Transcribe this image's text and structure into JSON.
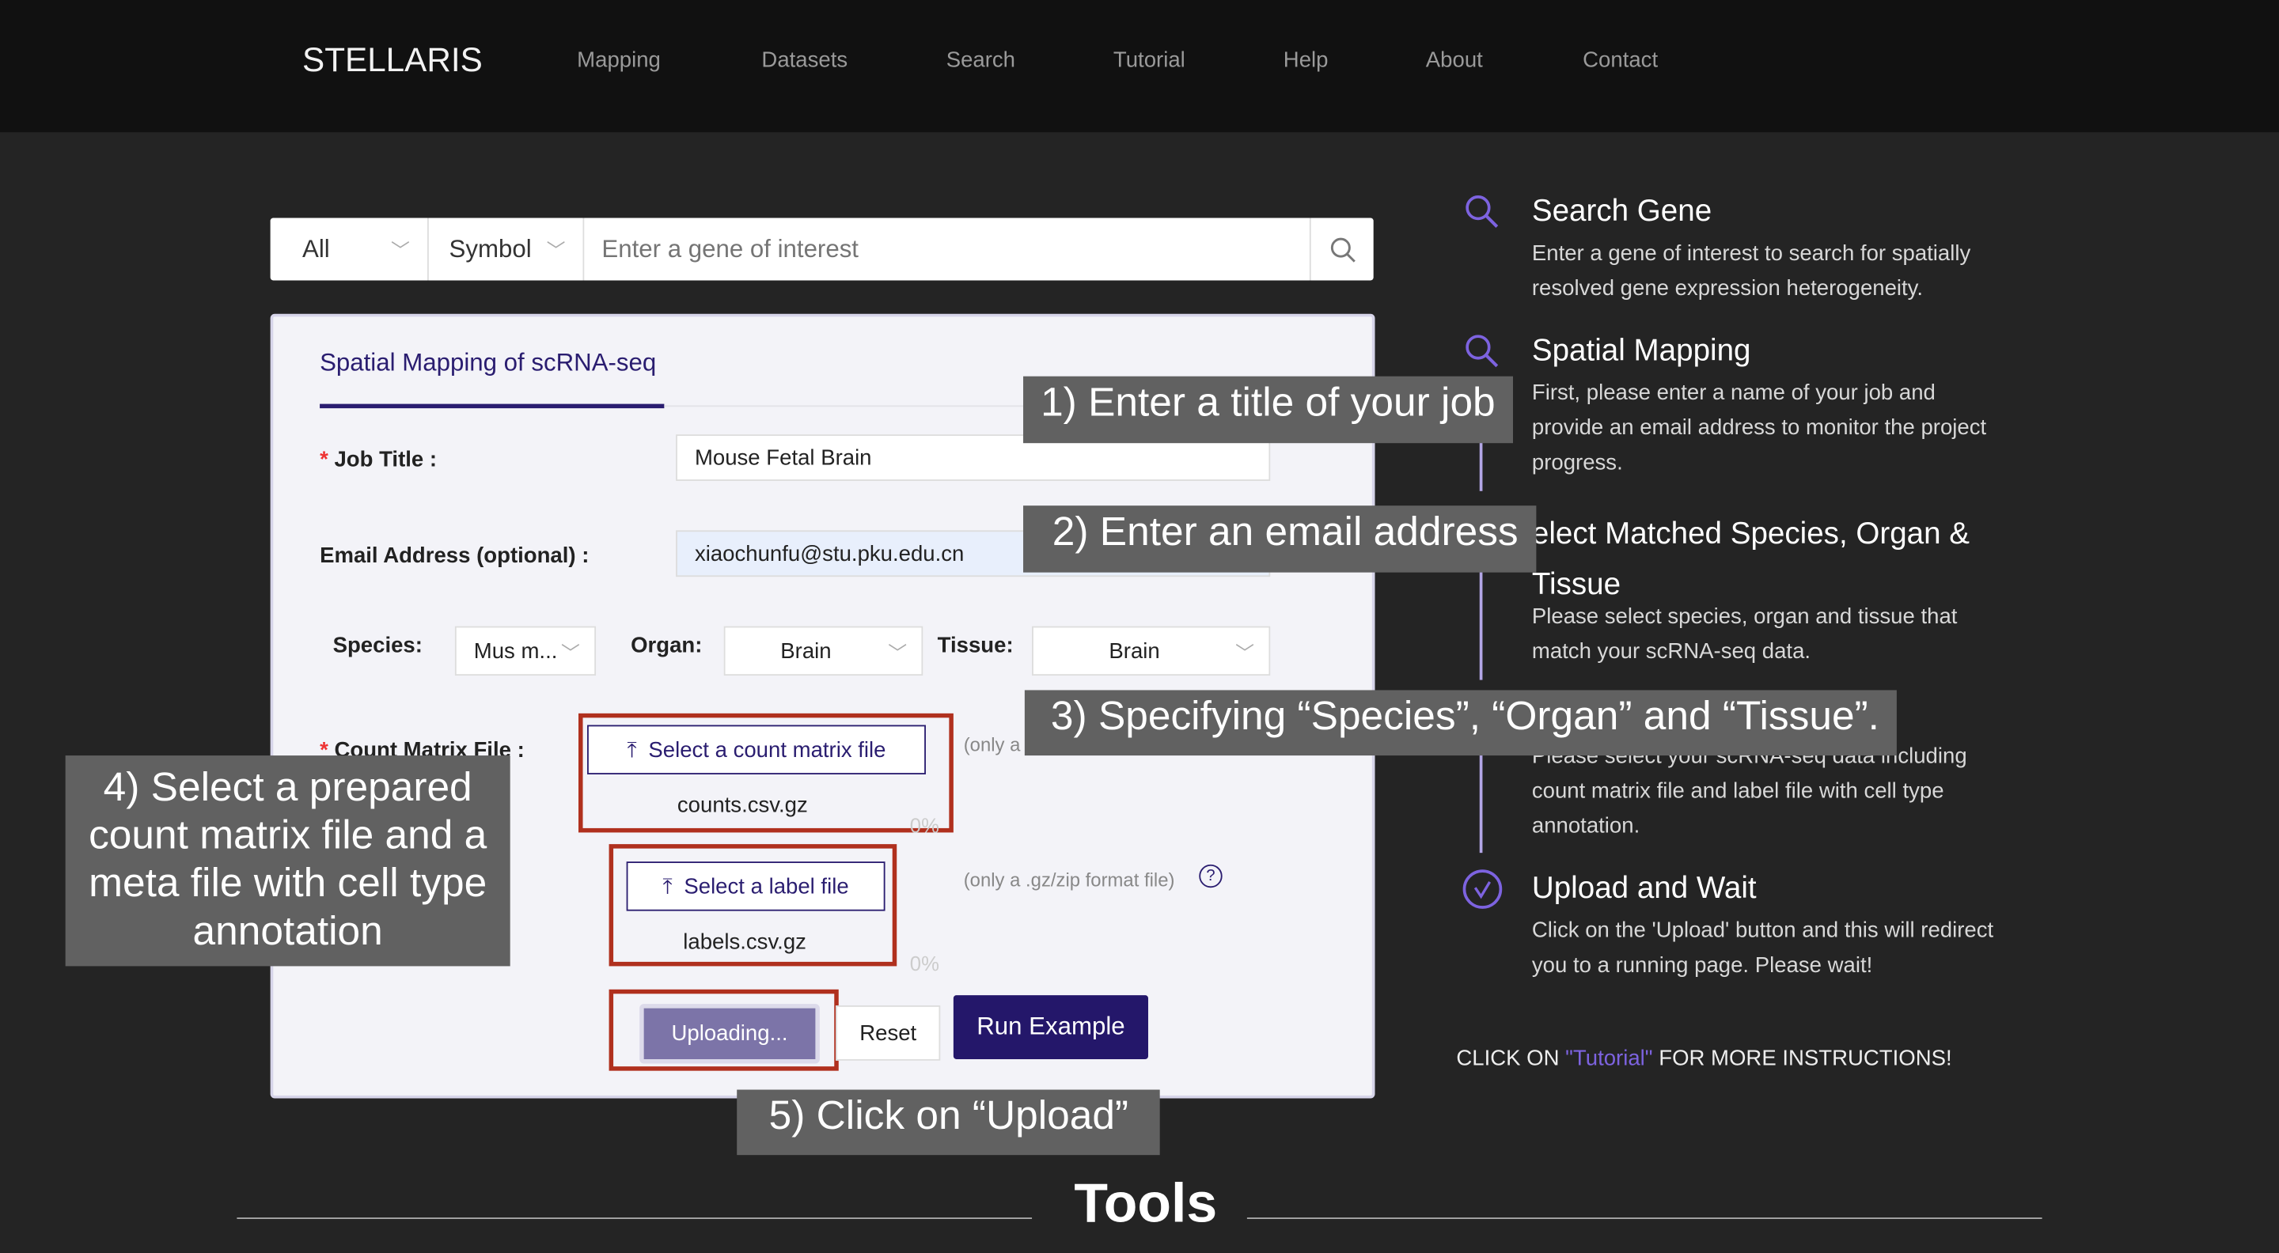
{
  "nav": {
    "brand": "STELLARIS",
    "items": [
      "Mapping",
      "Datasets",
      "Search",
      "Tutorial",
      "Help",
      "About",
      "Contact"
    ]
  },
  "search": {
    "scope": "All",
    "field": "Symbol",
    "placeholder": "Enter a gene of interest",
    "icon": "search-icon"
  },
  "form": {
    "tab": "Spatial Mapping of scRNA-seq",
    "job_title_label": "Job Title :",
    "job_title_value": "Mouse Fetal Brain",
    "email_label": "Email Address (optional) :",
    "email_value": "xiaochunfu@stu.pku.edu.cn",
    "species_label": "Species:",
    "species_value": "Mus m...",
    "organ_label": "Organ:",
    "organ_value": "Brain",
    "tissue_label": "Tissue:",
    "tissue_value": "Brain",
    "count_label": "Count Matrix File :",
    "count_button": "Select a count matrix file",
    "count_file": "counts.csv.gz",
    "count_hint": "(only a",
    "count_progress": "0%",
    "label_button": "Select a label file",
    "label_file": "labels.csv.gz",
    "label_hint": "(only a .gz/zip format file)",
    "label_progress": "0%",
    "upload_button": "Uploading...",
    "reset_button": "Reset",
    "run_button": "Run Example",
    "required_mark": "*"
  },
  "steps": [
    {
      "title": "Search Gene",
      "desc": "Enter a gene of interest to search for spatially resolved gene expression heterogeneity.",
      "icon": "search-icon"
    },
    {
      "title": "Spatial Mapping",
      "desc": "First, please enter a name of your job and provide an email address to monitor the project progress.",
      "icon": "search-icon"
    },
    {
      "title": "elect Matched Species, Organ & Tissue",
      "desc": "Please select species, organ and tissue that match your scRNA-seq data."
    },
    {
      "title": "",
      "desc": "Please select your scRNA-seq data including count matrix file and label file with cell type annotation."
    },
    {
      "title": "Upload and Wait",
      "desc": "Click on the 'Upload' button and this will redirect you to a running page. Please wait!",
      "icon": "check-circle-icon"
    }
  ],
  "tutorial_note": {
    "before": "CLICK ON ",
    "link": "\"Tutorial\"",
    "after": " FOR MORE INSTRUCTIONS!"
  },
  "callouts": [
    "1) Enter a title of your job",
    "2) Enter an email address",
    "3) Specifying “Species”, “Organ” and “Tissue”.",
    "4) Select a prepared count matrix file and a meta file with cell type annotation",
    "5) Click on “Upload”"
  ],
  "section_title": "Tools",
  "colors": {
    "accent": "#2a1d70",
    "step_icon": "#7d63e0",
    "highlight": "#b0301e",
    "callout_bg": "#616161"
  }
}
